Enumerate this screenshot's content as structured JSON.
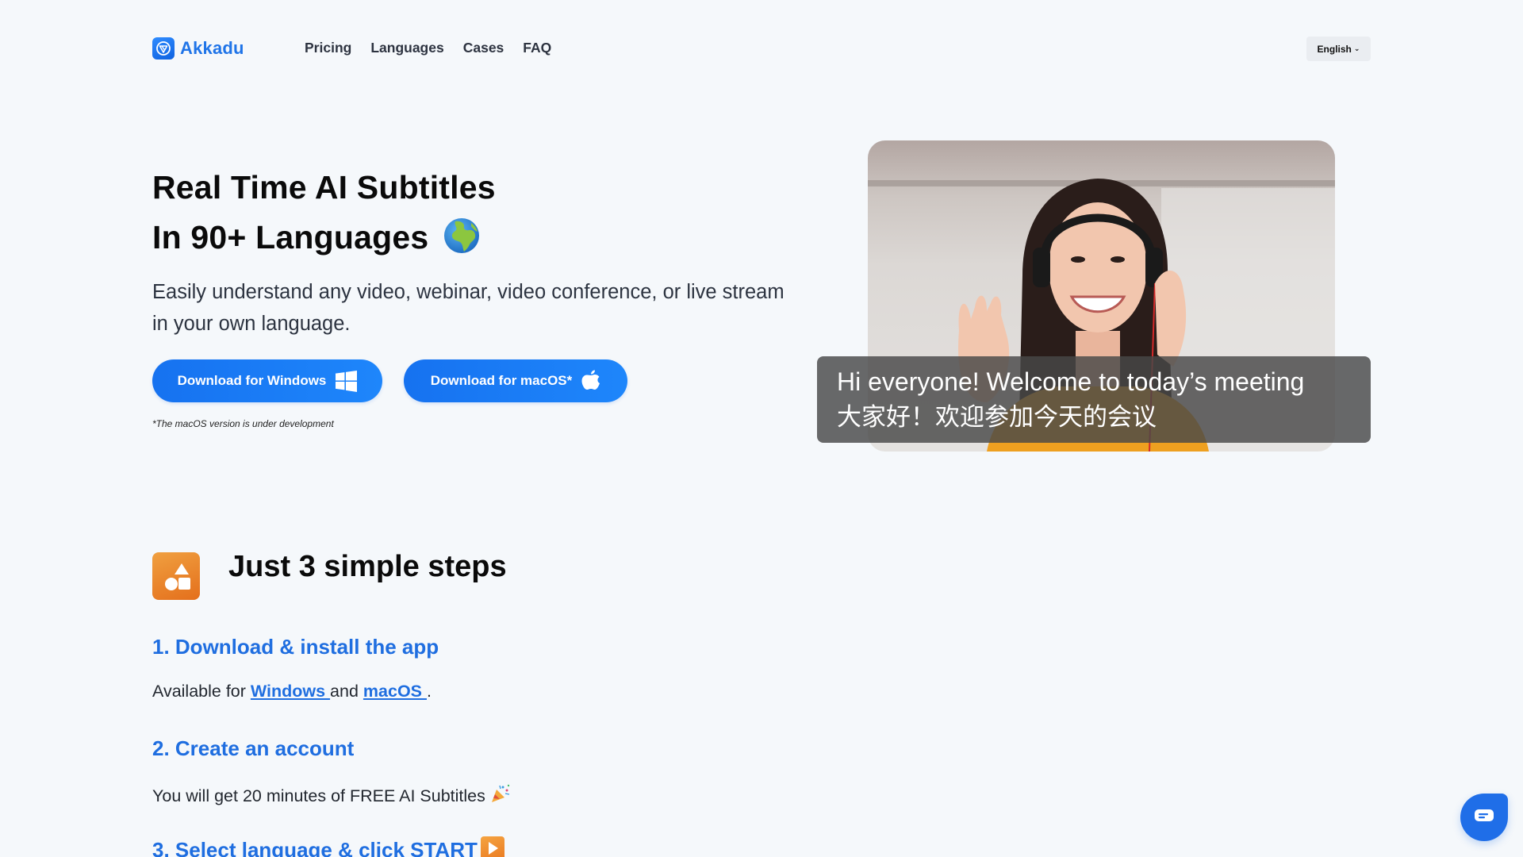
{
  "header": {
    "logo_text": "Akkadu",
    "logo_icon": "akkadu-logo-icon",
    "nav": [
      {
        "label": "Pricing"
      },
      {
        "label": "Languages"
      },
      {
        "label": "Cases"
      },
      {
        "label": "FAQ"
      }
    ],
    "language_selector": {
      "selected": "English",
      "icon": "chevron-down-icon"
    }
  },
  "hero": {
    "title_line1": "Real Time AI Subtitles",
    "title_line2": "In 90+ Languages",
    "title_emoji": "globe-europe-africa-icon",
    "subtitle": "Easily understand any video, webinar, video conference, or live stream in your own language.",
    "buttons": {
      "windows": {
        "label": "Download for Windows",
        "icon": "windows-icon"
      },
      "macos": {
        "label": "Download for macOS*",
        "icon": "apple-icon"
      }
    },
    "macos_note": "*The macOS version is under development",
    "image": {
      "description": "woman-with-headset-waving",
      "subtitle_en": "Hi everyone! Welcome to today’s meeting",
      "subtitle_zh": "大家好！欢迎参加今天的会议"
    }
  },
  "steps": {
    "icon": "shapes-icon",
    "title": "Just 3 simple steps",
    "items": [
      {
        "heading": "1. Download & install the app",
        "text_prefix": "Available for ",
        "link1": "Windows ",
        "text_middle": "and ",
        "link2": "macOS ",
        "text_suffix": "."
      },
      {
        "heading": "2. Create an account",
        "text": "You will get 20 minutes of FREE AI Subtitles",
        "emoji": "party-popper-icon"
      },
      {
        "heading": "3. Select language & click START",
        "emoji": "play-button-icon"
      }
    ]
  },
  "chat_widget": {
    "icon": "chat-bubble-icon"
  },
  "colors": {
    "background": "#f5f8fb",
    "brand_blue": "#1f6ee0",
    "button_blue": "#1672f0",
    "accent_orange": "#e8771f",
    "subtitle_overlay": "#484848"
  }
}
